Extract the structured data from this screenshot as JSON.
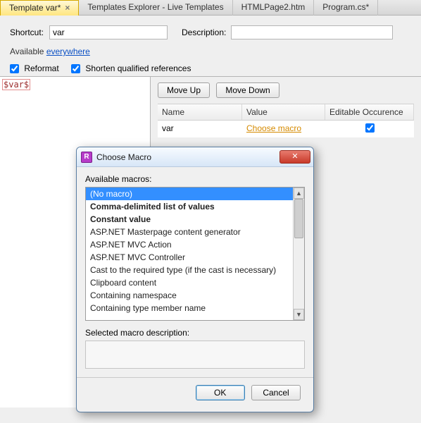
{
  "tabs": [
    {
      "label": "Template var*",
      "active": true
    },
    {
      "label": "Templates Explorer - Live Templates",
      "active": false
    },
    {
      "label": "HTMLPage2.htm",
      "active": false
    },
    {
      "label": "Program.cs*",
      "active": false
    }
  ],
  "form": {
    "shortcut_label": "Shortcut:",
    "shortcut_value": "var",
    "description_label": "Description:",
    "description_value": "",
    "available_label": "Available",
    "available_link": "everywhere",
    "reformat_label": "Reformat",
    "reformat_checked": true,
    "shorten_label": "Shorten qualified references",
    "shorten_checked": true
  },
  "editor": {
    "var_token": "$var$"
  },
  "buttons": {
    "move_up": "Move Up",
    "move_down": "Move Down"
  },
  "grid": {
    "headers": {
      "name": "Name",
      "value": "Value",
      "editable": "Editable Occurence"
    },
    "rows": [
      {
        "name": "var",
        "value": "Choose macro",
        "editable_checked": true
      }
    ]
  },
  "dialog": {
    "title": "Choose Macro",
    "icon_text": "R",
    "available_label": "Available macros:",
    "items": [
      {
        "label": "(No macro)",
        "selected": true,
        "bold": false
      },
      {
        "label": "Comma-delimited list of values",
        "selected": false,
        "bold": true
      },
      {
        "label": "Constant value",
        "selected": false,
        "bold": true
      },
      {
        "label": "ASP.NET Masterpage content generator",
        "selected": false,
        "bold": false
      },
      {
        "label": "ASP.NET MVC Action",
        "selected": false,
        "bold": false
      },
      {
        "label": "ASP.NET MVC Controller",
        "selected": false,
        "bold": false
      },
      {
        "label": "Cast to the required type (if the cast is necessary)",
        "selected": false,
        "bold": false
      },
      {
        "label": "Clipboard content",
        "selected": false,
        "bold": false
      },
      {
        "label": "Containing namespace",
        "selected": false,
        "bold": false
      },
      {
        "label": "Containing type member name",
        "selected": false,
        "bold": false
      }
    ],
    "selected_desc_label": "Selected macro description:",
    "selected_desc": "",
    "ok_label": "OK",
    "cancel_label": "Cancel",
    "close_glyph": "✕"
  }
}
